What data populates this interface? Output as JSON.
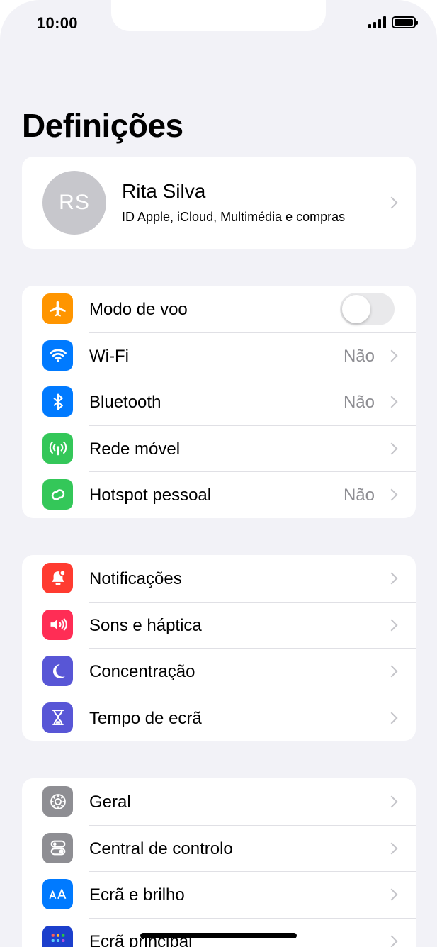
{
  "status_bar": {
    "time": "10:00"
  },
  "page_title": "Definições",
  "profile": {
    "initials": "RS",
    "name": "Rita Silva",
    "subtitle": "ID Apple, iCloud, Multimédia e compras"
  },
  "groups": [
    {
      "items": [
        {
          "label": "Modo de voo",
          "icon": "airplane-icon",
          "icon_color": "#ff9500",
          "toggle": false
        },
        {
          "label": "Wi-Fi",
          "icon": "wifi-icon",
          "icon_color": "#007aff",
          "value": "Não"
        },
        {
          "label": "Bluetooth",
          "icon": "bluetooth-icon",
          "icon_color": "#007aff",
          "value": "Não"
        },
        {
          "label": "Rede móvel",
          "icon": "antenna-icon",
          "icon_color": "#34c759"
        },
        {
          "label": "Hotspot pessoal",
          "icon": "hotspot-icon",
          "icon_color": "#34c759",
          "value": "Não"
        }
      ]
    },
    {
      "items": [
        {
          "label": "Notificações",
          "icon": "bell-icon",
          "icon_color": "#ff3b30"
        },
        {
          "label": "Sons e háptica",
          "icon": "speaker-icon",
          "icon_color": "#ff2d55"
        },
        {
          "label": "Concentração",
          "icon": "moon-icon",
          "icon_color": "#5856d6"
        },
        {
          "label": "Tempo de ecrã",
          "icon": "hourglass-icon",
          "icon_color": "#5856d6"
        }
      ]
    },
    {
      "items": [
        {
          "label": "Geral",
          "icon": "gear-icon",
          "icon_color": "#8e8e93"
        },
        {
          "label": "Central de controlo",
          "icon": "switches-icon",
          "icon_color": "#8e8e93"
        },
        {
          "label": "Ecrã e brilho",
          "icon": "text-size-icon",
          "icon_color": "#007aff"
        },
        {
          "label": "Ecrã principal",
          "icon": "home-grid-icon",
          "icon_color": "#1c3fcc"
        }
      ]
    }
  ]
}
